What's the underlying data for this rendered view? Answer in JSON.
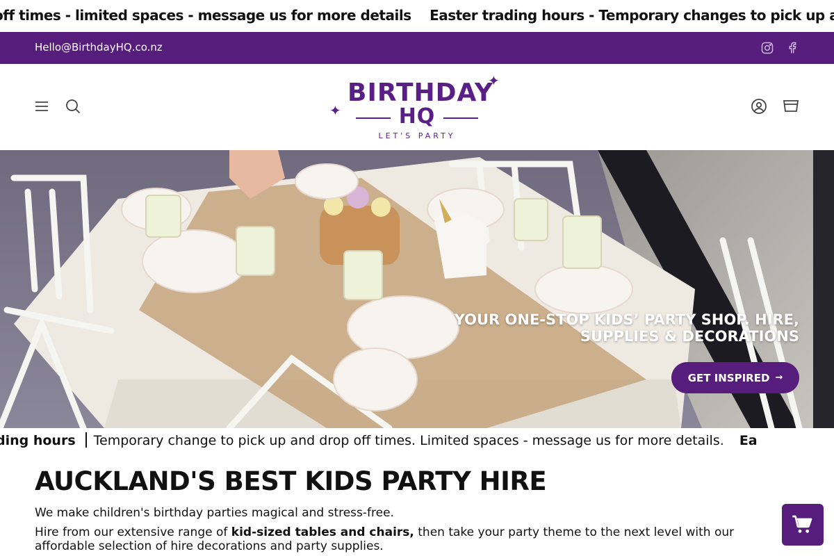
{
  "announcement_top": {
    "messages": [
      "off times - limited spaces - message us for more details",
      "Easter trading hours - Temporary changes to pick up and"
    ]
  },
  "topbar": {
    "email": "Hello@BirthdayHQ.co.nz",
    "social": [
      "instagram-icon",
      "facebook-icon"
    ]
  },
  "header": {
    "logo_line1": "BIRTHDAY",
    "logo_line2": "HQ",
    "logo_tagline": "LET'S PARTY"
  },
  "hero": {
    "headline_line1": "YOUR ONE-STOP KIDS’ PARTY SHOP. HIRE,",
    "headline_line2": "SUPPLIES & DECORATIONS",
    "cta_label": "GET INSPIRED",
    "cta_arrow": "→"
  },
  "announcement_mid": {
    "bold_fragment": "ding hours",
    "message": "Temporary change to pick up and drop off times. Limited spaces - message us for more details.",
    "trailing_fragment": "Ea"
  },
  "main": {
    "title": "AUCKLAND'S BEST KIDS PARTY HIRE",
    "intro": "We make children's birthday parties magical and stress-free.",
    "hire_prefix": "Hire from our extensive range of ",
    "hire_bold": "kid-sized tables and chairs,",
    "hire_suffix": " then take your party theme to the next level with our",
    "hire_line2": "affordable selection of hire decorations and party supplies."
  },
  "colors": {
    "brand_purple": "#561d7d"
  }
}
